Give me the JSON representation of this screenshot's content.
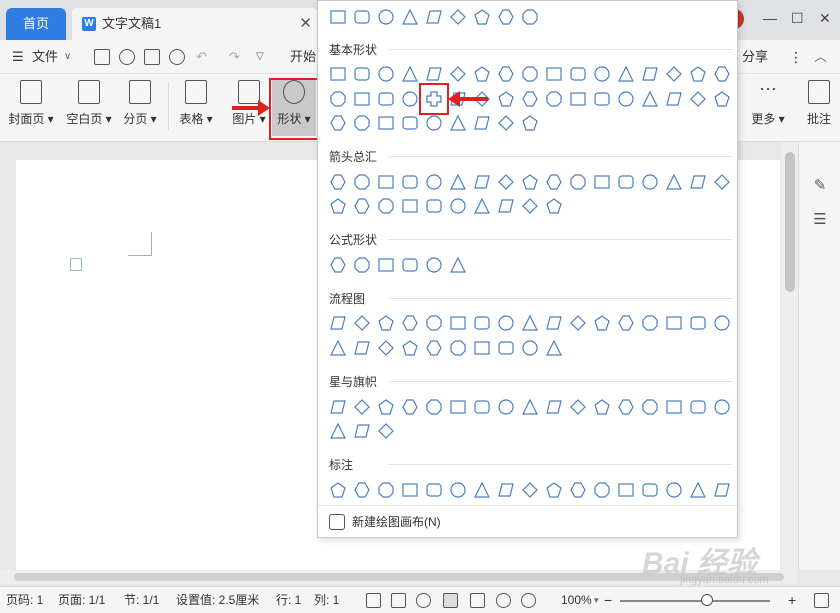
{
  "titlebar": {
    "home_tab": "首页",
    "doc_tab": "文字文稿1",
    "doc_icon_letter": "W",
    "close_glyph": "✕",
    "minimize_glyph": "—",
    "maximize_glyph": "☐",
    "window_close_glyph": "✕"
  },
  "menubar": {
    "file_label": "文件",
    "start_label": "开始",
    "share_label": "分享",
    "more_glyph": "⋮",
    "collapse_glyph": "︿"
  },
  "ribbon": {
    "buttons": [
      {
        "label": "封面页"
      },
      {
        "label": "空白页"
      },
      {
        "label": "分页"
      },
      {
        "label": "表格"
      },
      {
        "label": "图片"
      },
      {
        "label": "形状"
      },
      {
        "label": "更多"
      },
      {
        "label": "批注"
      }
    ]
  },
  "dropdown": {
    "sections": [
      {
        "title": "基本形状"
      },
      {
        "title": "箭头总汇"
      },
      {
        "title": "公式形状"
      },
      {
        "title": "流程图"
      },
      {
        "title": "星与旗帜"
      },
      {
        "title": "标注"
      }
    ],
    "footer_label": "新建绘图画布(N)"
  },
  "statusbar": {
    "page_num": "页码: 1",
    "pages": "页面: 1/1",
    "section": "节: 1/1",
    "setting": "设置值: 2.5厘米",
    "row": "行: 1",
    "col": "列: 1",
    "zoom": "100%"
  },
  "watermark": {
    "text": "Bai 经验",
    "sub": "jingyan.baidu.com"
  },
  "colors": {
    "accent": "#2f7de1",
    "highlight": "#e02020",
    "shape_stroke": "#4a7fc1"
  }
}
